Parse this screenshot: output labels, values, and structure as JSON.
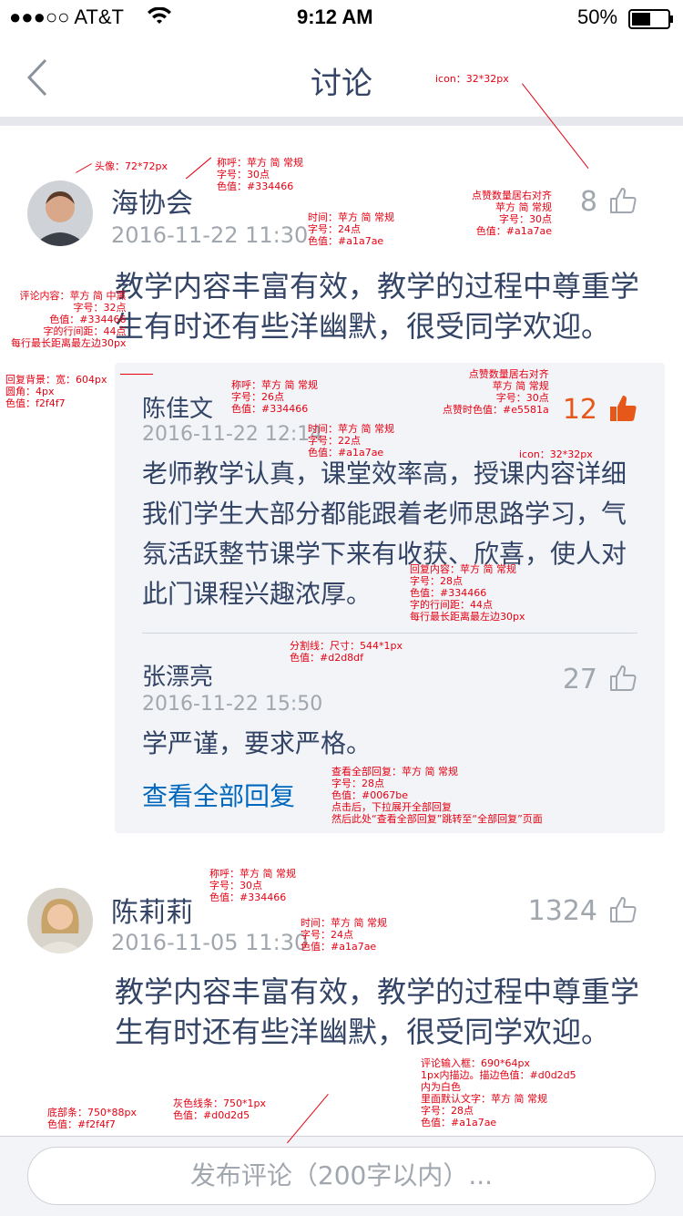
{
  "status_bar": {
    "carrier": "●●●○○ AT&T",
    "time": "9:12 AM",
    "battery": "50%"
  },
  "nav": {
    "title": "讨论",
    "back_icon": "chevron-left-icon"
  },
  "comments": [
    {
      "name": "海协会",
      "time": "2016-11-22 11:30",
      "likes": "8",
      "liked": false,
      "content": "教学内容丰富有效，教学的过程中尊重学生有时还有些洋幽默，很受同学欢迎。",
      "replies": [
        {
          "name": "陈佳文",
          "time": "2016-11-22 12:14",
          "likes": "12",
          "liked": true,
          "content": "老师教学认真，课堂效率高，授课内容详细我们学生大部分都能跟着老师思路学习，气氛活跃整节课学下来有收获、欣喜，使人对此门课程兴趣浓厚。"
        },
        {
          "name": "张漂亮",
          "time": "2016-11-22 15:50",
          "likes": "27",
          "liked": false,
          "content": "学严谨，要求严格。"
        }
      ],
      "view_all": "查看全部回复"
    },
    {
      "name": "陈莉莉",
      "time": "2016-11-05 11:30",
      "likes": "1324",
      "liked": false,
      "content": "教学内容丰富有效，教学的过程中尊重学生有时还有些洋幽默，很受同学欢迎。"
    }
  ],
  "composer": {
    "placeholder": "发布评论（200字以内）..."
  },
  "colors": {
    "name": "#334466",
    "time": "#a1a7ae",
    "liked": "#e5581a",
    "link": "#0067be",
    "reply_bg": "#f2f4f7",
    "divider": "#d2d8df"
  },
  "annotations": {
    "icon": "icon：32*32px",
    "avatar": "头像：72*72px",
    "name_spec": [
      "称呼：苹方 简 常规",
      "字号：30点",
      "色值：#334466"
    ],
    "time_spec": [
      "时间：苹方 简 常规",
      "字号：24点",
      "色值：#a1a7ae"
    ],
    "likes_spec": [
      "点赞数量居右对齐",
      "苹方 简 常规",
      "字号：30点",
      "色值：#a1a7ae"
    ],
    "content_spec": [
      "评论内容：苹方 简 中黑",
      "字号：32点",
      "色值：#334466",
      "字的行间距：44点",
      "每行最长距离最左边30px"
    ],
    "reply_bg_spec": [
      "回复背景：宽：604px",
      "圆角：4px",
      "色值：f2f4f7"
    ],
    "rname_spec": [
      "称呼：苹方 简 常规",
      "字号：26点",
      "色值：#334466"
    ],
    "rlikes_spec": [
      "点赞数量居右对齐",
      "苹方 简 常规",
      "字号：30点",
      "点赞时色值：#e5581a"
    ],
    "rtime_spec": [
      "时间：苹方 简 常规",
      "字号：22点",
      "色值：#a1a7ae"
    ],
    "rcontent_spec": [
      "回复内容：苹方 简 常规",
      "字号：28点",
      "色值：#334466",
      "字的行间距：44点",
      "每行最长距离最左边30px"
    ],
    "divider_spec": [
      "分割线：尺寸：544*1px",
      "色值：#d2d8df"
    ],
    "more_spec": [
      "查看全部回复：苹方 简 常规",
      "字号：28点",
      "色值：#0067be",
      "点击后，下拉展开全部回复",
      "然后此处“查看全部回复”跳转至“全部回复”页面"
    ],
    "input_spec": [
      "评论输入框：690*64px",
      "1px内描边。描边色值：#d0d2d5",
      "内为白色",
      "里面默认文字：苹方 简 常规",
      "字号：28点",
      "色值：#a1a7ae"
    ],
    "bottom_spec": [
      "底部条：750*88px",
      "色值：#f2f4f7"
    ],
    "gray_line_spec": [
      "灰色线条：750*1px",
      "色值：#d0d2d5"
    ]
  }
}
